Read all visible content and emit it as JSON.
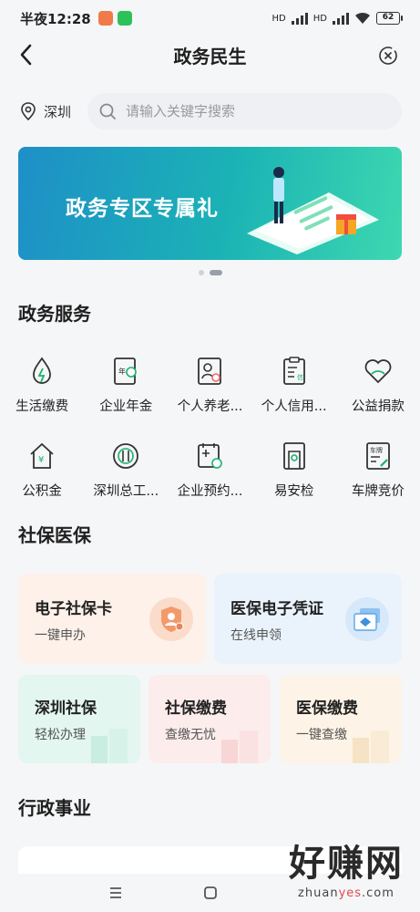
{
  "status_bar": {
    "time": "半夜12:28",
    "battery": "62",
    "net1": "HD",
    "net2": "HD"
  },
  "nav": {
    "title": "政务民生"
  },
  "search": {
    "location": "深圳",
    "placeholder": "请输入关键字搜索"
  },
  "banner": {
    "text": "政务专区专属礼"
  },
  "gov_services": {
    "title": "政务服务",
    "items": [
      {
        "label": "生活缴费",
        "icon": "water-drop-icon"
      },
      {
        "label": "企业年金",
        "icon": "annuity-card-icon"
      },
      {
        "label": "个人养老...",
        "icon": "pension-profile-icon"
      },
      {
        "label": "个人信用...",
        "icon": "credit-document-icon"
      },
      {
        "label": "公益捐款",
        "icon": "charity-heart-icon"
      },
      {
        "label": "公积金",
        "icon": "housing-fund-icon"
      },
      {
        "label": "深圳总工...",
        "icon": "union-badge-icon"
      },
      {
        "label": "企业预约...",
        "icon": "enterprise-appointment-icon"
      },
      {
        "label": "易安检",
        "icon": "security-gate-icon"
      },
      {
        "label": "车牌竞价",
        "icon": "license-plate-icon"
      }
    ]
  },
  "social": {
    "title": "社保医保",
    "big_cards": [
      {
        "title": "电子社保卡",
        "sub": "一键申办",
        "bg": "#fdf1ea",
        "icon": "social-security-shield-icon"
      },
      {
        "title": "医保电子凭证",
        "sub": "在线申领",
        "bg": "#eaf3fc",
        "icon": "medical-card-icon"
      }
    ],
    "small_cards": [
      {
        "title": "深圳社保",
        "sub": "轻松办理",
        "bg": "#e3f6f0"
      },
      {
        "title": "社保缴费",
        "sub": "查缴无忧",
        "bg": "#fdecec"
      },
      {
        "title": "医保缴费",
        "sub": "一键查缴",
        "bg": "#fdf3e6"
      }
    ]
  },
  "admin": {
    "title": "行政事业"
  },
  "watermark": {
    "big": "好赚网",
    "small_a": "zhuan",
    "small_b": "yes",
    "small_c": ".com"
  },
  "colors": {
    "accent": "#18b36b",
    "banner_start": "#1e8fc8",
    "banner_end": "#3dd8b0"
  }
}
